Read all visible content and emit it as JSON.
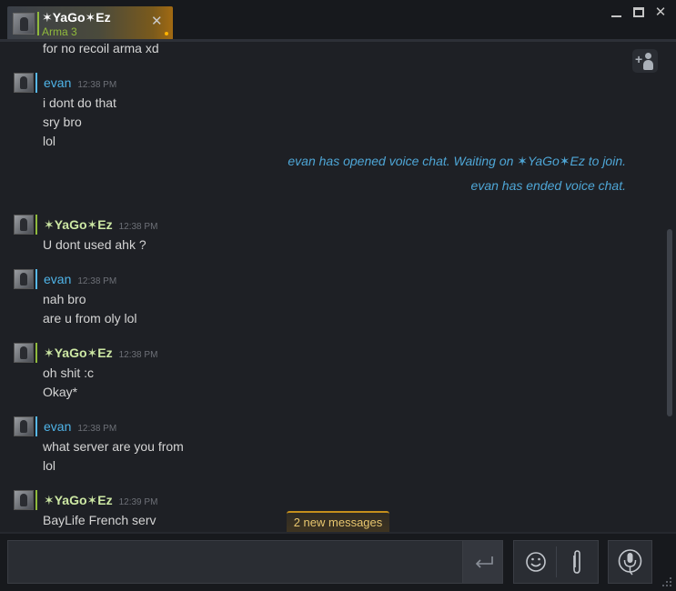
{
  "tab": {
    "name": "✶YaGo✶Ez",
    "game": "Arma 3",
    "close_glyph": "✕"
  },
  "window": {
    "minimize": "minimize",
    "maximize": "maximize",
    "close": "✕"
  },
  "messages": [
    {
      "sender": "",
      "time": "",
      "lines": [
        "for no recoil arma xd"
      ]
    },
    {
      "sender": "evan",
      "status": "online",
      "time": "12:38 PM",
      "lines": [
        "i dont do that",
        "sry bro",
        "lol"
      ]
    },
    {
      "sender": "✶YaGo✶Ez",
      "status": "ingame",
      "time": "12:38 PM",
      "lines": [
        "U dont used ahk ?"
      ]
    },
    {
      "sender": "evan",
      "status": "online",
      "time": "12:38 PM",
      "lines": [
        "nah bro",
        "are u from oly lol"
      ]
    },
    {
      "sender": "✶YaGo✶Ez",
      "status": "ingame",
      "time": "12:38 PM",
      "lines": [
        "oh shit :c",
        "Okay*"
      ]
    },
    {
      "sender": "evan",
      "status": "online",
      "time": "12:38 PM",
      "lines": [
        "what server are you from",
        "lol"
      ]
    },
    {
      "sender": "✶YaGo✶Ez",
      "status": "ingame",
      "time": "12:39 PM",
      "lines": [
        "BayLife French serv"
      ]
    }
  ],
  "system_messages": [
    "evan has opened voice chat. Waiting on  ✶YaGo✶Ez to join.",
    "evan has ended voice chat."
  ],
  "new_messages_label": "2 new messages",
  "input": {
    "value": ""
  },
  "colors": {
    "online": "#57b8e8",
    "ingame": "#90ba3c",
    "system_text": "#4ea6d6",
    "accent": "#c58f1c"
  },
  "icons": [
    "add-friend-icon",
    "send-icon",
    "emoji-icon",
    "attachment-icon",
    "voice-chat-icon",
    "resize-grip-icon"
  ]
}
